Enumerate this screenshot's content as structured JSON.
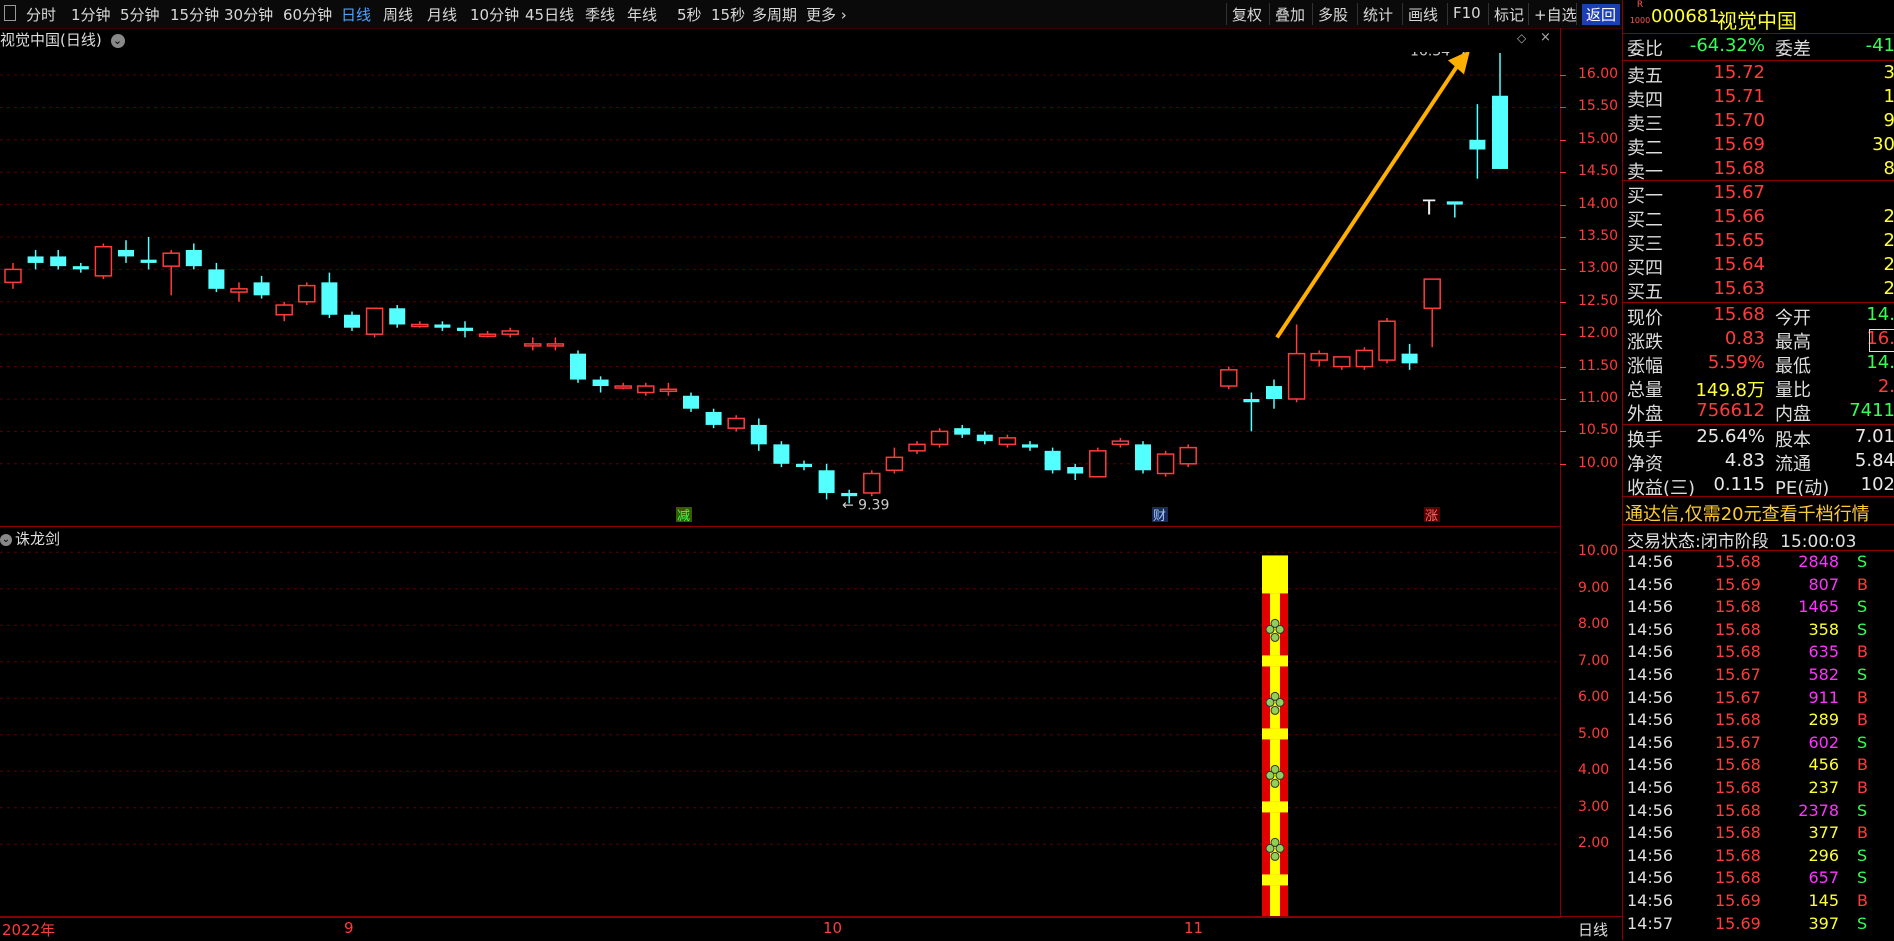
{
  "toolbar": {
    "periods": [
      "分时",
      "1分钟",
      "5分钟",
      "15分钟",
      "30分钟",
      "60分钟",
      "日线",
      "周线",
      "月线",
      "10分钟",
      "45日线",
      "季线",
      "年线",
      "5秒",
      "15秒",
      "多周期",
      "更多"
    ],
    "active_period": "日线",
    "right_items": [
      "复权",
      "叠加",
      "多股",
      "统计",
      "画线",
      "F10",
      "标记",
      "+自选",
      "返回"
    ]
  },
  "main_chart": {
    "title": "视觉中国(日线)",
    "price_ticks": [
      "16.00",
      "15.50",
      "15.00",
      "14.50",
      "14.00",
      "13.50",
      "13.00",
      "12.50",
      "12.00",
      "11.50",
      "11.00",
      "10.50",
      "10.00"
    ],
    "high_label": "16.34",
    "low_label": "9.39",
    "markers": [
      "减",
      "财",
      "涨"
    ],
    "colors": {
      "up": "#ff3b3b",
      "down": "#54ffff",
      "arrow": "#ffb000"
    }
  },
  "indicator": {
    "title": "诛龙剑",
    "ticks": [
      "10.00",
      "9.00",
      "8.00",
      "7.00",
      "6.00",
      "5.00",
      "4.00",
      "3.00",
      "2.00"
    ]
  },
  "date_axis": {
    "labels": [
      "2022年",
      "9",
      "10",
      "11"
    ],
    "period_label": "日线"
  },
  "quote": {
    "code": "000681",
    "name": "视觉中国",
    "badge_top": "R",
    "badge_bottom": "1000",
    "wei_bi_label": "委比",
    "wei_bi": "-64.32%",
    "wei_cha_label": "委差",
    "wei_cha": "-41",
    "asks": [
      {
        "label": "卖五",
        "price": "15.72",
        "vol": "3"
      },
      {
        "label": "卖四",
        "price": "15.71",
        "vol": "1"
      },
      {
        "label": "卖三",
        "price": "15.70",
        "vol": "9"
      },
      {
        "label": "卖二",
        "price": "15.69",
        "vol": "30"
      },
      {
        "label": "卖一",
        "price": "15.68",
        "vol": "8"
      }
    ],
    "bids": [
      {
        "label": "买一",
        "price": "15.67",
        "vol": ""
      },
      {
        "label": "买二",
        "price": "15.66",
        "vol": "2"
      },
      {
        "label": "买三",
        "price": "15.65",
        "vol": "2"
      },
      {
        "label": "买四",
        "price": "15.64",
        "vol": "2"
      },
      {
        "label": "买五",
        "price": "15.63",
        "vol": "2"
      }
    ],
    "stats": [
      {
        "l1": "现价",
        "v1": "15.68",
        "l2": "今开",
        "v2": "14."
      },
      {
        "l1": "涨跌",
        "v1": "0.83",
        "l2": "最高",
        "v2": "16."
      },
      {
        "l1": "涨幅",
        "v1": "5.59%",
        "l2": "最低",
        "v2": "14."
      },
      {
        "l1": "总量",
        "v1": "149.8万",
        "l2": "量比",
        "v2": "2."
      },
      {
        "l1": "外盘",
        "v1": "756612",
        "l2": "内盘",
        "v2": "7411"
      }
    ],
    "fundamentals": [
      {
        "l1": "换手",
        "v1": "25.64%",
        "l2": "股本",
        "v2": "7.01"
      },
      {
        "l1": "净资",
        "v1": "4.83",
        "l2": "流通",
        "v2": "5.84"
      },
      {
        "l1": "收益(三)",
        "v1": "0.115",
        "l2": "PE(动)",
        "v2": "102"
      }
    ],
    "promo": "通达信,仅需20元查看千档行情",
    "trade_status_label": "交易状态:",
    "trade_status": "闭市阶段",
    "trade_time": "15:00:03"
  },
  "ticks": [
    {
      "t": "14:56",
      "p": "15.68",
      "v": "2848",
      "bs": "S"
    },
    {
      "t": "14:56",
      "p": "15.69",
      "v": "807",
      "bs": "B"
    },
    {
      "t": "14:56",
      "p": "15.68",
      "v": "1465",
      "bs": "S"
    },
    {
      "t": "14:56",
      "p": "15.68",
      "v": "358",
      "bs": "S"
    },
    {
      "t": "14:56",
      "p": "15.68",
      "v": "635",
      "bs": "B"
    },
    {
      "t": "14:56",
      "p": "15.67",
      "v": "582",
      "bs": "S"
    },
    {
      "t": "14:56",
      "p": "15.67",
      "v": "911",
      "bs": "B"
    },
    {
      "t": "14:56",
      "p": "15.68",
      "v": "289",
      "bs": "B"
    },
    {
      "t": "14:56",
      "p": "15.67",
      "v": "602",
      "bs": "S"
    },
    {
      "t": "14:56",
      "p": "15.68",
      "v": "456",
      "bs": "B"
    },
    {
      "t": "14:56",
      "p": "15.68",
      "v": "237",
      "bs": "B"
    },
    {
      "t": "14:56",
      "p": "15.68",
      "v": "2378",
      "bs": "S"
    },
    {
      "t": "14:56",
      "p": "15.68",
      "v": "377",
      "bs": "B"
    },
    {
      "t": "14:56",
      "p": "15.68",
      "v": "296",
      "bs": "S"
    },
    {
      "t": "14:56",
      "p": "15.68",
      "v": "657",
      "bs": "S"
    },
    {
      "t": "14:56",
      "p": "15.69",
      "v": "145",
      "bs": "B"
    },
    {
      "t": "14:57",
      "p": "15.69",
      "v": "397",
      "bs": "S"
    }
  ],
  "chart_data": {
    "type": "candlestick",
    "price_range": [
      9.39,
      16.34
    ],
    "candles": [
      [
        12.8,
        13.1,
        12.7,
        13.0
      ],
      [
        13.2,
        13.3,
        13.0,
        13.1
      ],
      [
        13.2,
        13.3,
        13.0,
        13.05
      ],
      [
        13.05,
        13.1,
        12.95,
        13.0
      ],
      [
        12.9,
        13.4,
        12.85,
        13.35
      ],
      [
        13.3,
        13.45,
        13.1,
        13.2
      ],
      [
        13.15,
        13.5,
        13.0,
        13.1
      ],
      [
        13.05,
        13.3,
        12.6,
        13.25
      ],
      [
        13.3,
        13.4,
        13.0,
        13.05
      ],
      [
        13.0,
        13.1,
        12.65,
        12.7
      ],
      [
        12.65,
        12.8,
        12.5,
        12.7
      ],
      [
        12.8,
        12.9,
        12.55,
        12.6
      ],
      [
        12.3,
        12.5,
        12.2,
        12.45
      ],
      [
        12.5,
        12.8,
        12.45,
        12.75
      ],
      [
        12.8,
        12.95,
        12.25,
        12.3
      ],
      [
        12.3,
        12.35,
        12.05,
        12.1
      ],
      [
        12.0,
        12.4,
        11.95,
        12.4
      ],
      [
        12.4,
        12.45,
        12.1,
        12.15
      ],
      [
        12.15,
        12.2,
        12.1,
        12.15
      ],
      [
        12.15,
        12.2,
        12.05,
        12.1
      ],
      [
        12.1,
        12.2,
        11.95,
        12.05
      ],
      [
        12.0,
        12.05,
        11.95,
        12.0
      ],
      [
        12.0,
        12.1,
        11.95,
        12.05
      ],
      [
        11.85,
        11.95,
        11.75,
        11.85
      ],
      [
        11.85,
        11.95,
        11.75,
        11.85
      ],
      [
        11.7,
        11.75,
        11.25,
        11.3
      ],
      [
        11.3,
        11.35,
        11.1,
        11.2
      ],
      [
        11.2,
        11.25,
        11.15,
        11.2
      ],
      [
        11.1,
        11.25,
        11.05,
        11.2
      ],
      [
        11.15,
        11.25,
        11.05,
        11.15
      ],
      [
        11.05,
        11.1,
        10.8,
        10.85
      ],
      [
        10.8,
        10.85,
        10.55,
        10.6
      ],
      [
        10.55,
        10.75,
        10.5,
        10.7
      ],
      [
        10.6,
        10.7,
        10.2,
        10.3
      ],
      [
        10.3,
        10.35,
        9.95,
        10.0
      ],
      [
        10.0,
        10.05,
        9.9,
        9.95
      ],
      [
        9.9,
        10.0,
        9.45,
        9.55
      ],
      [
        9.55,
        9.6,
        9.39,
        9.5
      ],
      [
        9.55,
        9.9,
        9.5,
        9.85
      ],
      [
        9.9,
        10.25,
        9.85,
        10.1
      ],
      [
        10.2,
        10.35,
        10.15,
        10.3
      ],
      [
        10.3,
        10.55,
        10.25,
        10.5
      ],
      [
        10.55,
        10.6,
        10.4,
        10.45
      ],
      [
        10.45,
        10.5,
        10.3,
        10.35
      ],
      [
        10.3,
        10.45,
        10.25,
        10.4
      ],
      [
        10.3,
        10.35,
        10.2,
        10.25
      ],
      [
        10.2,
        10.25,
        9.85,
        9.9
      ],
      [
        9.95,
        10.0,
        9.75,
        9.85
      ],
      [
        9.8,
        10.25,
        9.8,
        10.2
      ],
      [
        10.3,
        10.4,
        10.25,
        10.35
      ],
      [
        10.3,
        10.35,
        9.85,
        9.9
      ],
      [
        9.85,
        10.2,
        9.8,
        10.15
      ],
      [
        10.0,
        10.3,
        9.95,
        10.25
      ],
      [
        11.2,
        11.5,
        11.15,
        11.45
      ],
      [
        11.0,
        11.1,
        10.5,
        10.95
      ],
      [
        11.2,
        11.3,
        10.85,
        11.0
      ],
      [
        11.0,
        12.15,
        10.95,
        11.7
      ],
      [
        11.6,
        11.75,
        11.5,
        11.7
      ],
      [
        11.5,
        11.65,
        11.45,
        11.65
      ],
      [
        11.5,
        11.8,
        11.45,
        11.75
      ],
      [
        11.6,
        12.25,
        11.55,
        12.2
      ],
      [
        11.7,
        11.85,
        11.45,
        11.55
      ],
      [
        12.4,
        12.85,
        11.8,
        12.85
      ],
      [
        14.05,
        14.0,
        13.8,
        14.0
      ],
      [
        15.0,
        15.55,
        14.4,
        14.85
      ],
      [
        15.68,
        16.34,
        14.55,
        14.55
      ]
    ],
    "indicator_signal": {
      "type": "bar",
      "y_range": [
        1,
        10.5
      ],
      "value_top": 10.0,
      "value_bottom": 0.0
    }
  }
}
